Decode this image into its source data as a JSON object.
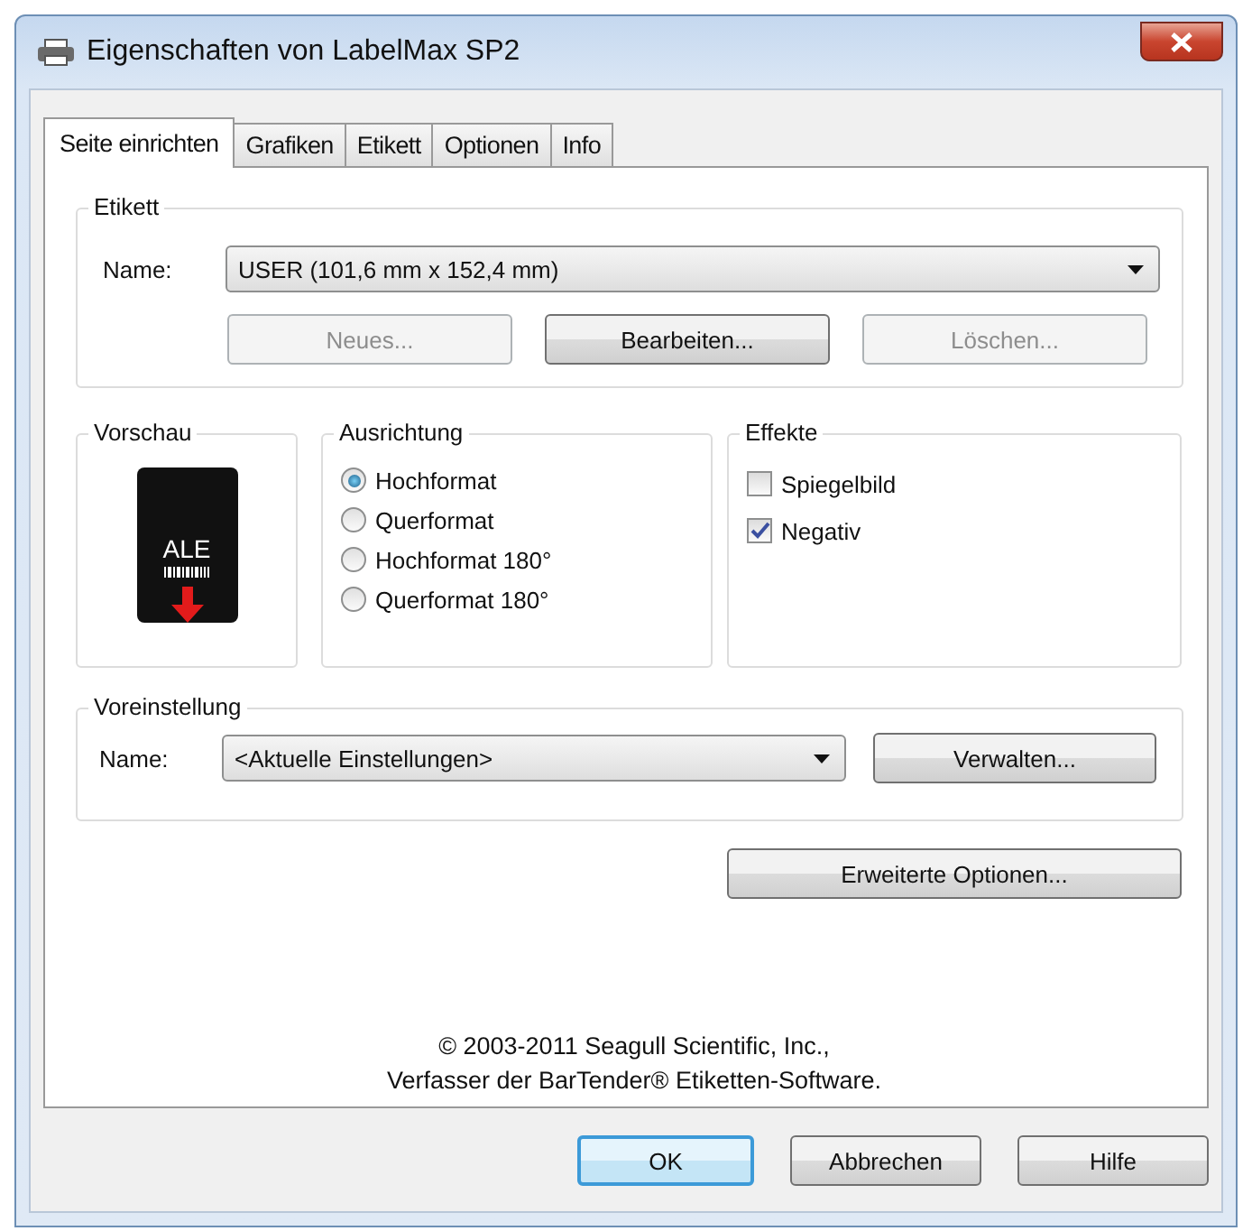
{
  "window": {
    "title": "Eigenschaften von LabelMax SP2"
  },
  "tabs": [
    {
      "label": "Seite einrichten",
      "selected": true
    },
    {
      "label": "Grafiken",
      "selected": false
    },
    {
      "label": "Etikett",
      "selected": false
    },
    {
      "label": "Optionen",
      "selected": false
    },
    {
      "label": "Info",
      "selected": false
    }
  ],
  "etikett": {
    "title": "Etikett",
    "name_label": "Name:",
    "name_value": "USER (101,6 mm x 152,4 mm)",
    "buttons": [
      {
        "label": "Neues...",
        "disabled": true
      },
      {
        "label": "Bearbeiten...",
        "disabled": false
      },
      {
        "label": "Löschen...",
        "disabled": true
      }
    ]
  },
  "vorschau": {
    "title": "Vorschau",
    "preview_text": "ALE"
  },
  "ausrichtung": {
    "title": "Ausrichtung",
    "options": [
      {
        "label": "Hochformat",
        "selected": true
      },
      {
        "label": "Querformat",
        "selected": false
      },
      {
        "label": "Hochformat 180°",
        "selected": false
      },
      {
        "label": "Querformat 180°",
        "selected": false
      }
    ]
  },
  "effekte": {
    "title": "Effekte",
    "options": [
      {
        "label": "Spiegelbild",
        "checked": false
      },
      {
        "label": "Negativ",
        "checked": true
      }
    ]
  },
  "voreinstellung": {
    "title": "Voreinstellung",
    "name_label": "Name:",
    "name_value": "<Aktuelle Einstellungen>",
    "button": "Verwalten..."
  },
  "advanced_button": "Erweiterte Optionen...",
  "copyright": [
    "© 2003-2011 Seagull Scientific, Inc.,",
    "Verfasser der BarTender® Etiketten-Software."
  ],
  "buttons": [
    {
      "label": "OK",
      "default": true
    },
    {
      "label": "Abbrechen",
      "default": false
    },
    {
      "label": "Hilfe",
      "default": false
    }
  ]
}
